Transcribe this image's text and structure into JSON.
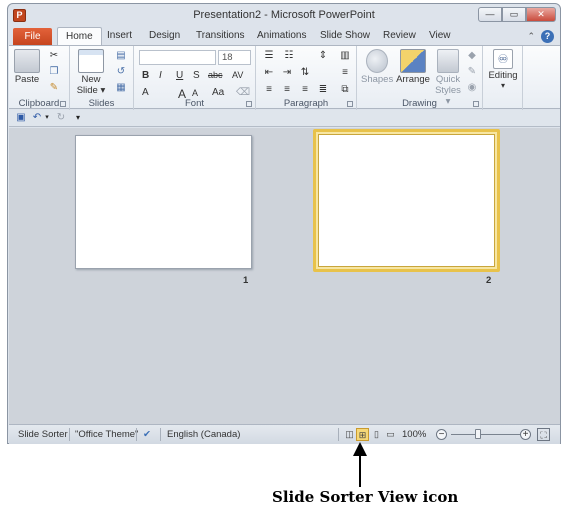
{
  "window": {
    "title": "Presentation2 - Microsoft PowerPoint",
    "app_icon_letter": "P",
    "controls": {
      "minimize": "—",
      "restore": "▭",
      "close": "✕"
    }
  },
  "ribbon_tabs": {
    "file": "File",
    "items": [
      "Home",
      "Insert",
      "Design",
      "Transitions",
      "Animations",
      "Slide Show",
      "Review",
      "View"
    ],
    "active": "Home",
    "help": "?"
  },
  "ribbon": {
    "clipboard": {
      "label": "Clipboard",
      "paste": "Paste"
    },
    "slides": {
      "label": "Slides",
      "new_slide_line1": "New",
      "new_slide_line2": "Slide ▾"
    },
    "font": {
      "label": "Font",
      "font_name": "",
      "font_size": "18",
      "bold": "B",
      "italic": "I",
      "underline": "U",
      "strike": "S",
      "abc": "abc",
      "av": "AV",
      "grow": "A",
      "shrink": "A",
      "aa": "Aa",
      "color": "A"
    },
    "paragraph": {
      "label": "Paragraph"
    },
    "drawing": {
      "label": "Drawing",
      "shapes": "Shapes",
      "arrange": "Arrange",
      "quick_styles_line1": "Quick",
      "quick_styles_line2": "Styles ▾"
    },
    "editing": {
      "label": "Editing"
    }
  },
  "quick_access": {
    "customize": "▾"
  },
  "slides": [
    {
      "number": "1"
    },
    {
      "number": "2"
    }
  ],
  "statusbar": {
    "view_name": "Slide Sorter",
    "theme": "\"Office Theme\"",
    "language": "English (Canada)",
    "zoom": "100%",
    "zoom_out": "−",
    "zoom_in": "+"
  },
  "annotation": {
    "caption": "Slide Sorter View icon"
  },
  "colors": {
    "file_tab": "#c4431d",
    "selected_slide_border": "#e8c24a",
    "workspace": "#ced3da"
  }
}
